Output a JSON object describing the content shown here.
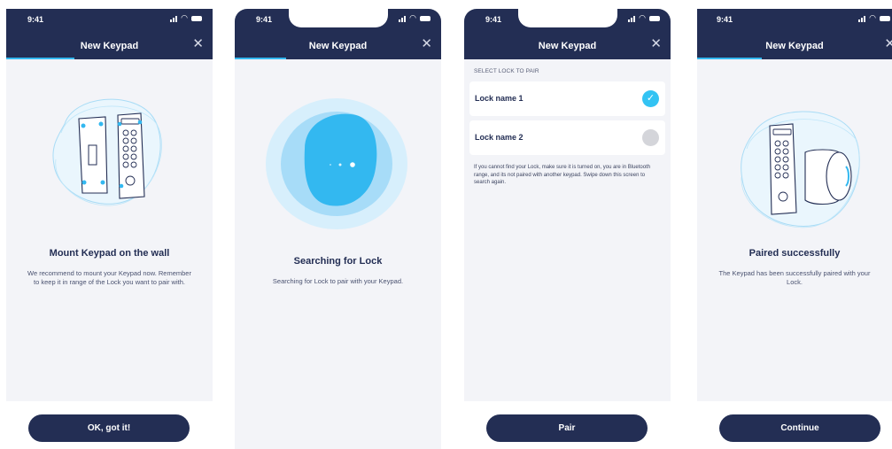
{
  "status_time": "9:41",
  "colors": {
    "header": "#232e54",
    "accent": "#33b8f0",
    "button": "#232e54",
    "screen_bg": "#f3f4f8"
  },
  "screen1": {
    "title": "New Keypad",
    "progress": 0.33,
    "heading": "Mount Keypad on the wall",
    "description": "We recommend to mount your Keypad now. Remember to keep it in range of the Lock you want to pair with.",
    "button": "OK, got it!"
  },
  "screen2": {
    "title": "New Keypad",
    "progress": 0.25,
    "heading": "Searching for Lock",
    "description": "Searching for Lock to pair with your Keypad."
  },
  "screen3": {
    "title": "New Keypad",
    "section_label": "SELECT LOCK TO PAIR",
    "locks": [
      {
        "name": "Lock name 1",
        "selected": true
      },
      {
        "name": "Lock name 2",
        "selected": false
      }
    ],
    "help": "If you cannot find your Lock, make sure it is turned on, you are in Bluetooth range, and its not paired with another keypad. Swipe down this screen to search again.",
    "button": "Pair"
  },
  "screen4": {
    "title": "New Keypad",
    "progress": 0.33,
    "heading": "Paired successfully",
    "description": "The Keypad has been successfully paired with your Lock.",
    "button": "Continue"
  }
}
